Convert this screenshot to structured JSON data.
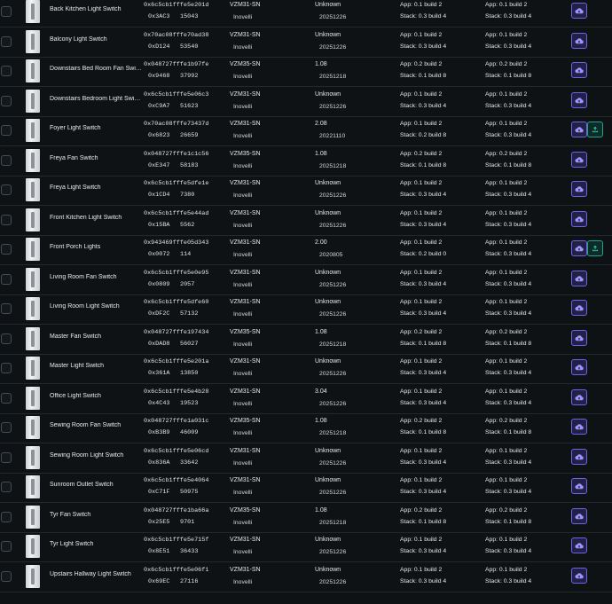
{
  "colors": {
    "accent_purple": "#6e62e6",
    "accent_green": "#1fa58a",
    "background": "#0f1215"
  },
  "icons": {
    "thumbnail": "light-switch-icon",
    "cloud": "cloud-upload-icon",
    "upload": "upload-icon"
  },
  "devices": [
    {
      "name": "Back Kitchen Light Switch",
      "ieee": "0x6c5cb1fffe5e201d",
      "nwk": "0x3AC3",
      "id": "15043",
      "model": "VZM31-SN",
      "manufacturer": "Inovelli",
      "firmware": "Unknown",
      "date": "20251226",
      "app1": "App: 0.1 build 2",
      "stack1": "Stack: 0.3 build 4",
      "app2": "App: 0.1 build 2",
      "stack2": "Stack: 0.3 build 4",
      "extra_button": false
    },
    {
      "name": "Balcony Light Switch",
      "ieee": "0x70ac08fffe70ad38",
      "nwk": "0xD124",
      "id": "53540",
      "model": "VZM31-SN",
      "manufacturer": "Inovelli",
      "firmware": "Unknown",
      "date": "20251226",
      "app1": "App: 0.1 build 2",
      "stack1": "Stack: 0.3 build 4",
      "app2": "App: 0.1 build 2",
      "stack2": "Stack: 0.3 build 4",
      "extra_button": false
    },
    {
      "name": "Downstairs Bed Room Fan Switch",
      "ieee": "0x048727fffe1b97fe",
      "nwk": "0x9468",
      "id": "37992",
      "model": "VZM35-SN",
      "manufacturer": "Inovelli",
      "firmware": "1.08",
      "date": "20251218",
      "app1": "App: 0.2 build 2",
      "stack1": "Stack: 0.1 build 8",
      "app2": "App: 0.2 build 2",
      "stack2": "Stack: 0.1 build 8",
      "extra_button": false
    },
    {
      "name": "Downstairs Bedroom Light Switch",
      "ieee": "0x6c5cb1fffe5e06c3",
      "nwk": "0xC9A7",
      "id": "51623",
      "model": "VZM31-SN",
      "manufacturer": "Inovelli",
      "firmware": "Unknown",
      "date": "20251226",
      "app1": "App: 0.1 build 2",
      "stack1": "Stack: 0.3 build 4",
      "app2": "App: 0.1 build 2",
      "stack2": "Stack: 0.3 build 4",
      "extra_button": false
    },
    {
      "name": "Foyer Light Switch",
      "ieee": "0x70ac08fffe73437d",
      "nwk": "0x6823",
      "id": "26659",
      "model": "VZM31-SN",
      "manufacturer": "Inovelli",
      "firmware": "2.08",
      "date": "20221110",
      "app1": "App: 0.1 build 2",
      "stack1": "Stack: 0.2 build 8",
      "app2": "App: 0.1 build 2",
      "stack2": "Stack: 0.3 build 4",
      "extra_button": true
    },
    {
      "name": "Freya Fan Switch",
      "ieee": "0x048727fffe1c1c56",
      "nwk": "0xE347",
      "id": "58183",
      "model": "VZM35-SN",
      "manufacturer": "Inovelli",
      "firmware": "1.08",
      "date": "20251218",
      "app1": "App: 0.2 build 2",
      "stack1": "Stack: 0.1 build 8",
      "app2": "App: 0.2 build 2",
      "stack2": "Stack: 0.1 build 8",
      "extra_button": false
    },
    {
      "name": "Freya Light Switch",
      "ieee": "0x6c5cb1fffe5dfe1e",
      "nwk": "0x1CD4",
      "id": "7380",
      "model": "VZM31-SN",
      "manufacturer": "Inovelli",
      "firmware": "Unknown",
      "date": "20251226",
      "app1": "App: 0.1 build 2",
      "stack1": "Stack: 0.3 build 4",
      "app2": "App: 0.1 build 2",
      "stack2": "Stack: 0.3 build 4",
      "extra_button": false
    },
    {
      "name": "Front Kitchen Light Switch",
      "ieee": "0x6c5cb1fffe5e44ad",
      "nwk": "0x15BA",
      "id": "5562",
      "model": "VZM31-SN",
      "manufacturer": "Inovelli",
      "firmware": "Unknown",
      "date": "20251226",
      "app1": "App: 0.1 build 2",
      "stack1": "Stack: 0.3 build 4",
      "app2": "App: 0.1 build 2",
      "stack2": "Stack: 0.3 build 4",
      "extra_button": false
    },
    {
      "name": "Front Porch Lights",
      "ieee": "0x943469fffe05d343",
      "nwk": "0x0072",
      "id": "114",
      "model": "VZM31-SN",
      "manufacturer": "Inovelli",
      "firmware": "2.00",
      "date": "2020805",
      "app1": "App: 0.1 build 2",
      "stack1": "Stack: 0.2 build 0",
      "app2": "App: 0.1 build 2",
      "stack2": "Stack: 0.3 build 4",
      "extra_button": true
    },
    {
      "name": "Living Room Fan Switch",
      "ieee": "0x6c5cb1fffe5e0e95",
      "nwk": "0x0809",
      "id": "2057",
      "model": "VZM31-SN",
      "manufacturer": "Inovelli",
      "firmware": "Unknown",
      "date": "20251226",
      "app1": "App: 0.1 build 2",
      "stack1": "Stack: 0.3 build 4",
      "app2": "App: 0.1 build 2",
      "stack2": "Stack: 0.3 build 4",
      "extra_button": false
    },
    {
      "name": "Living Room Light Switch",
      "ieee": "0x6c5cb1fffe5dfe60",
      "nwk": "0xDF2C",
      "id": "57132",
      "model": "VZM31-SN",
      "manufacturer": "Inovelli",
      "firmware": "Unknown",
      "date": "20251226",
      "app1": "App: 0.1 build 2",
      "stack1": "Stack: 0.3 build 4",
      "app2": "App: 0.1 build 2",
      "stack2": "Stack: 0.3 build 4",
      "extra_button": false
    },
    {
      "name": "Master Fan Switch",
      "ieee": "0x048727fffe197434",
      "nwk": "0xDAD8",
      "id": "56027",
      "model": "VZM35-SN",
      "manufacturer": "Inovelli",
      "firmware": "1.08",
      "date": "20251218",
      "app1": "App: 0.2 build 2",
      "stack1": "Stack: 0.1 build 8",
      "app2": "App: 0.2 build 2",
      "stack2": "Stack: 0.1 build 8",
      "extra_button": false
    },
    {
      "name": "Master Light Switch",
      "ieee": "0x6c5cb1fffe5e201a",
      "nwk": "0x361A",
      "id": "13850",
      "model": "VZM31-SN",
      "manufacturer": "Inovelli",
      "firmware": "Unknown",
      "date": "20251226",
      "app1": "App: 0.1 build 2",
      "stack1": "Stack: 0.3 build 4",
      "app2": "App: 0.1 build 2",
      "stack2": "Stack: 0.3 build 4",
      "extra_button": false
    },
    {
      "name": "Office Light Switch",
      "ieee": "0x6c5cb1fffe5e4b28",
      "nwk": "0x4C43",
      "id": "19523",
      "model": "VZM31-SN",
      "manufacturer": "Inovelli",
      "firmware": "3.04",
      "date": "20251226",
      "app1": "App: 0.1 build 2",
      "stack1": "Stack: 0.3 build 4",
      "app2": "App: 0.1 build 2",
      "stack2": "Stack: 0.3 build 4",
      "extra_button": false
    },
    {
      "name": "Sewing Room Fan Switch",
      "ieee": "0x048727fffe1a031c",
      "nwk": "0xB3B9",
      "id": "46009",
      "model": "VZM35-SN",
      "manufacturer": "Inovelli",
      "firmware": "1.08",
      "date": "20251218",
      "app1": "App: 0.2 build 2",
      "stack1": "Stack: 0.1 build 8",
      "app2": "App: 0.2 build 2",
      "stack2": "Stack: 0.1 build 8",
      "extra_button": false
    },
    {
      "name": "Sewing Room Light Switch",
      "ieee": "0x6c5cb1fffe5e06cd",
      "nwk": "0x836A",
      "id": "33642",
      "model": "VZM31-SN",
      "manufacturer": "Inovelli",
      "firmware": "Unknown",
      "date": "20251226",
      "app1": "App: 0.1 build 2",
      "stack1": "Stack: 0.3 build 4",
      "app2": "App: 0.1 build 2",
      "stack2": "Stack: 0.3 build 4",
      "extra_button": false
    },
    {
      "name": "Sunroom Outlet Switch",
      "ieee": "0x6c5cb1fffe5e4064",
      "nwk": "0xC71F",
      "id": "50975",
      "model": "VZM31-SN",
      "manufacturer": "Inovelli",
      "firmware": "Unknown",
      "date": "20251226",
      "app1": "App: 0.1 build 2",
      "stack1": "Stack: 0.3 build 4",
      "app2": "App: 0.1 build 2",
      "stack2": "Stack: 0.3 build 4",
      "extra_button": false
    },
    {
      "name": "Tyr Fan Switch",
      "ieee": "0x048727fffe1ba66a",
      "nwk": "0x25E5",
      "id": "9701",
      "model": "VZM35-SN",
      "manufacturer": "Inovelli",
      "firmware": "1.08",
      "date": "20251218",
      "app1": "App: 0.2 build 2",
      "stack1": "Stack: 0.1 build 8",
      "app2": "App: 0.2 build 2",
      "stack2": "Stack: 0.1 build 8",
      "extra_button": false
    },
    {
      "name": "Tyr Light Switch",
      "ieee": "0x6c5cb1fffe5e715f",
      "nwk": "0x8E51",
      "id": "36433",
      "model": "VZM31-SN",
      "manufacturer": "Inovelli",
      "firmware": "Unknown",
      "date": "20251226",
      "app1": "App: 0.1 build 2",
      "stack1": "Stack: 0.3 build 4",
      "app2": "App: 0.1 build 2",
      "stack2": "Stack: 0.3 build 4",
      "extra_button": false
    },
    {
      "name": "Upstairs Hallway Light Switch",
      "ieee": "0x6c5cb1fffe5e06f1",
      "nwk": "0x69EC",
      "id": "27116",
      "model": "VZM31-SN",
      "manufacturer": "Inovelli",
      "firmware": "Unknown",
      "date": "20251226",
      "app1": "App: 0.1 build 2",
      "stack1": "Stack: 0.3 build 4",
      "app2": "App: 0.1 build 2",
      "stack2": "Stack: 0.3 build 4",
      "extra_button": false
    }
  ]
}
